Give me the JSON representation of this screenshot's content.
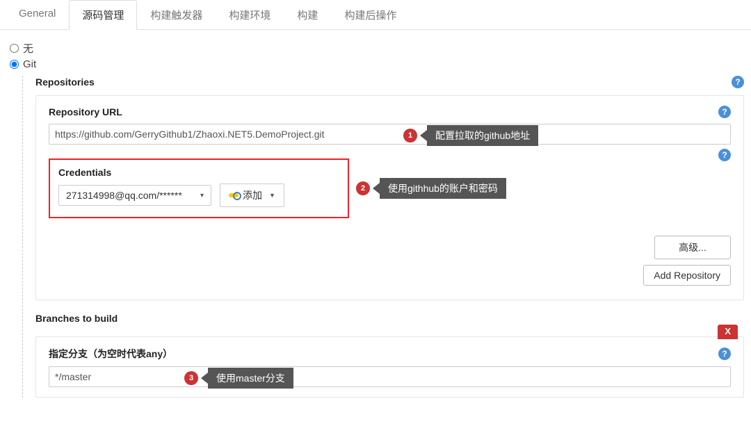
{
  "tabs": {
    "general": "General",
    "scm": "源码管理",
    "triggers": "构建触发器",
    "env": "构建环境",
    "build": "构建",
    "post": "构建后操作"
  },
  "scm_options": {
    "none": "无",
    "git": "Git"
  },
  "repositories": {
    "title": "Repositories",
    "url_label": "Repository URL",
    "url_value": "https://github.com/GerryGithub1/Zhaoxi.NET5.DemoProject.git",
    "credentials_label": "Credentials",
    "credentials_value": "271314998@qq.com/******",
    "add_button": "添加",
    "advanced_button": "高级...",
    "add_repo_button": "Add Repository"
  },
  "branches": {
    "title": "Branches to build",
    "field_label": "指定分支（为空时代表any）",
    "value": "*/master",
    "delete": "X"
  },
  "annotations": {
    "ann1_num": "1",
    "ann1_text": "配置拉取的github地址",
    "ann2_num": "2",
    "ann2_text": "使用githhub的账户和密码",
    "ann3_num": "3",
    "ann3_text": "使用master分支"
  },
  "help": "?"
}
